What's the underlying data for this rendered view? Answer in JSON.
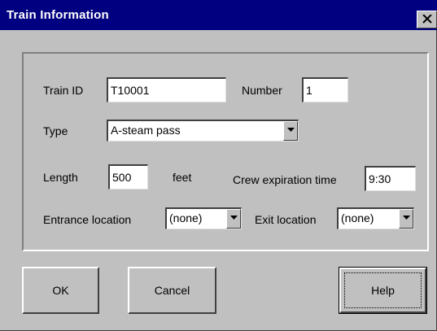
{
  "window": {
    "title": "Train Information"
  },
  "form": {
    "train_id_label": "Train ID",
    "train_id_value": "T10001",
    "number_label": "Number",
    "number_value": "1",
    "type_label": "Type",
    "type_value": "A-steam pass",
    "length_label": "Length",
    "length_value": "500",
    "length_unit": "feet",
    "crew_label": "Crew expiration time",
    "crew_value": "9:30",
    "entrance_label": "Entrance location",
    "entrance_value": "(none)",
    "exit_label": "Exit location",
    "exit_value": "(none)"
  },
  "buttons": {
    "ok": "OK",
    "cancel": "Cancel",
    "help": "Help"
  },
  "icons": {
    "close": "close-icon",
    "dropdown": "chevron-down-icon"
  }
}
